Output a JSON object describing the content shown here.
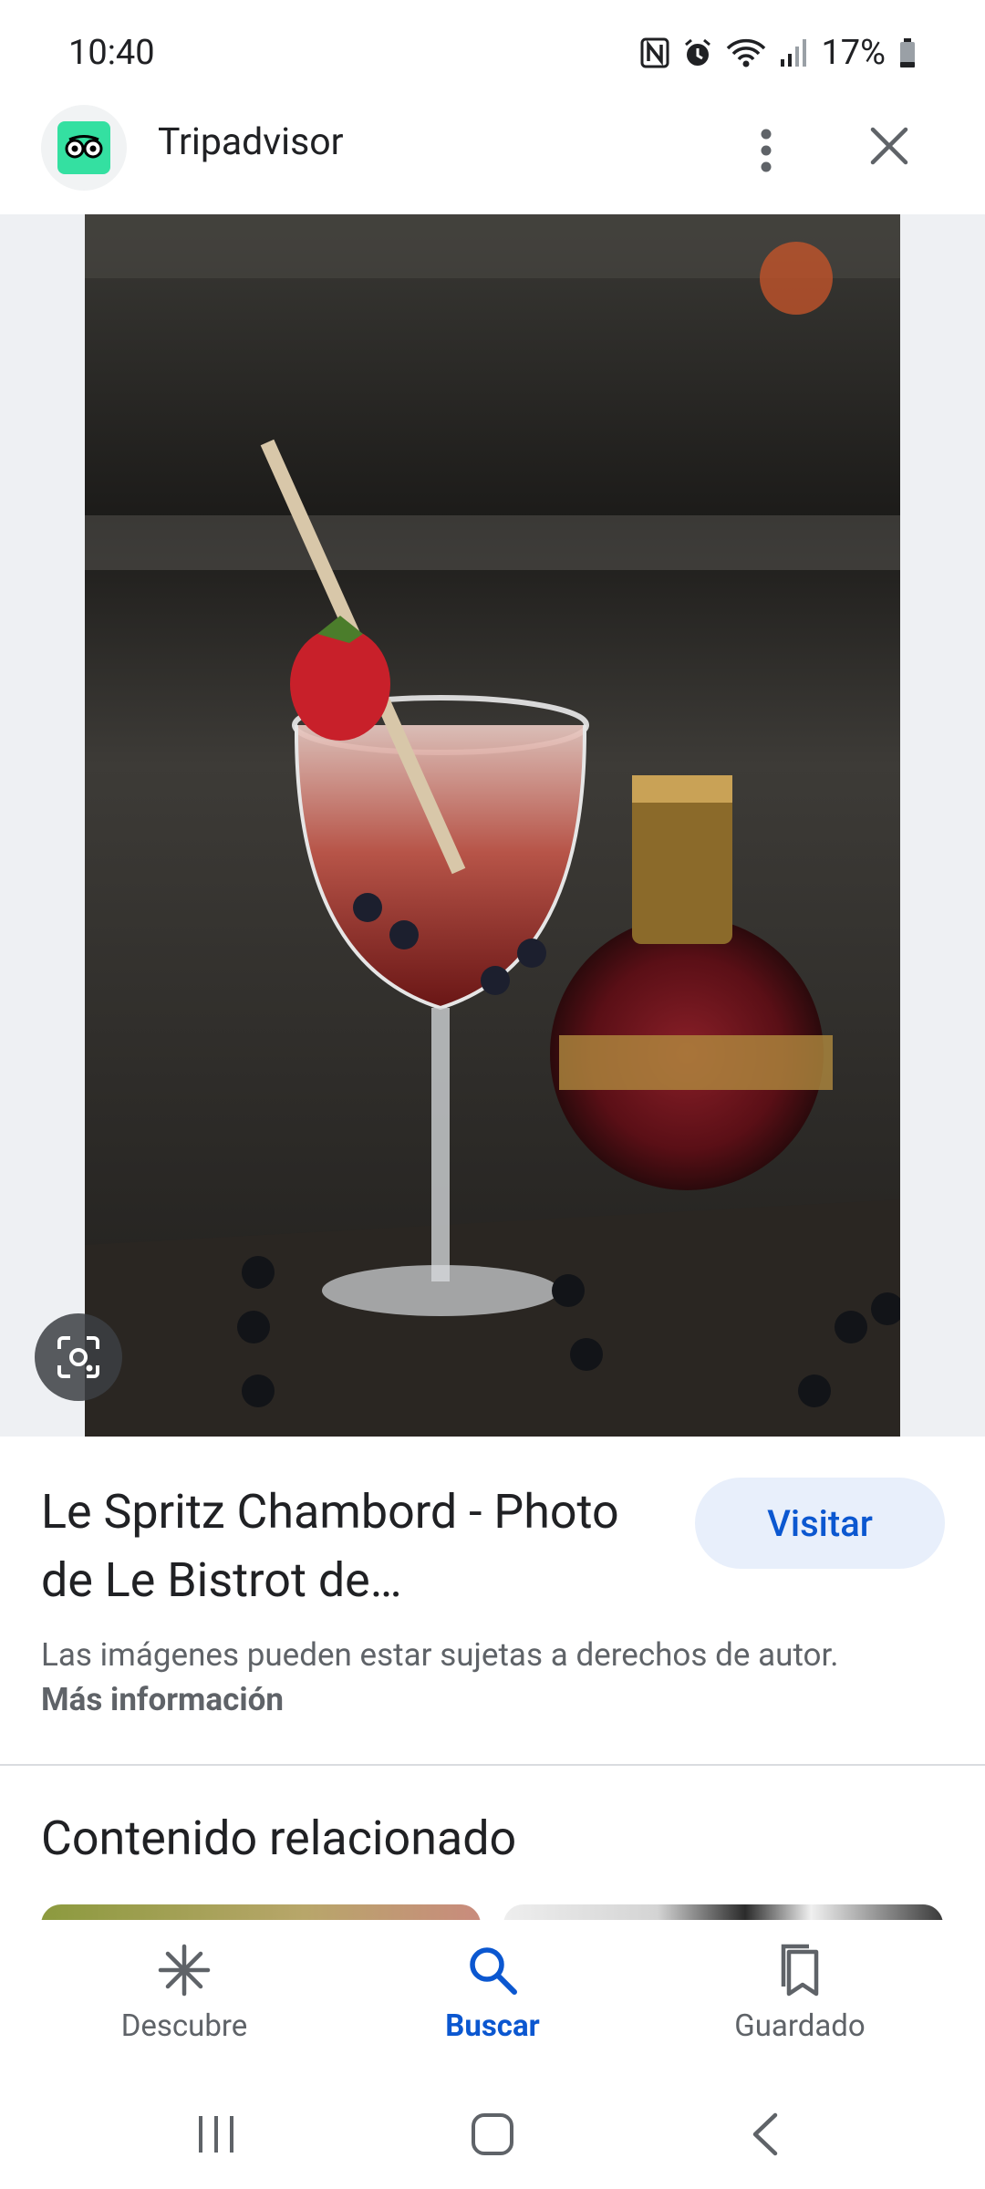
{
  "status_bar": {
    "time": "10:40",
    "battery": "17%",
    "icons": [
      "nfc-icon",
      "alarm-icon",
      "wifi-icon",
      "signal-icon",
      "battery-icon"
    ]
  },
  "header": {
    "site_name": "Tripadvisor",
    "logo_color": "#34e0a1",
    "more_icon": "more-vert-icon",
    "close_icon": "close-icon"
  },
  "image": {
    "description_icon": "lens-icon"
  },
  "result": {
    "title": "Le Spritz Chambord - Photo de Le Bistrot de…",
    "visit_label": "Visitar",
    "copyright_text": "Las imágenes pueden estar sujetas a derechos de autor.",
    "more_info_label": "Más información"
  },
  "related": {
    "title": "Contenido relacionado"
  },
  "bottom_nav": {
    "items": [
      {
        "label": "Descubre",
        "icon": "discover-icon",
        "active": false
      },
      {
        "label": "Buscar",
        "icon": "search-icon",
        "active": true
      },
      {
        "label": "Guardado",
        "icon": "saved-icon",
        "active": false
      }
    ]
  },
  "colors": {
    "accent": "#0b57d0",
    "visit_bg": "#e8effb"
  }
}
